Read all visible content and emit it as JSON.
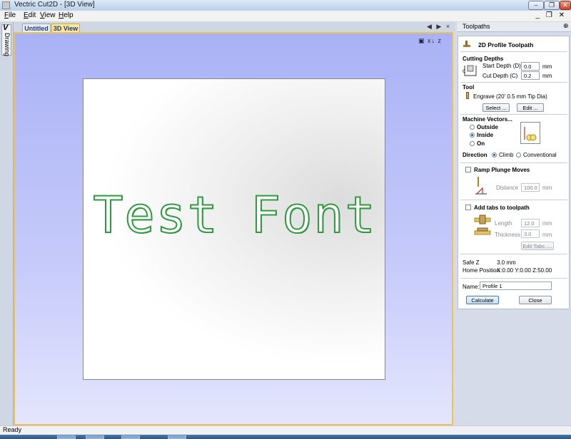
{
  "window": {
    "title": "Vectric Cut2D - [3D View]"
  },
  "menu": [
    "File",
    "Edit",
    "View",
    "Help"
  ],
  "mdi_controls": "_ &#x25A1; ×",
  "left_tab": {
    "glyph": "V",
    "label": "Drawing"
  },
  "doc_tabs": [
    {
      "label": "Untitled",
      "active": false
    },
    {
      "label": "3D View",
      "active": true
    }
  ],
  "doc_tab_nav": "◀ ▶ ×",
  "view": {
    "text": "Test Font",
    "text_color": "#2e9b3e",
    "view_icons": "▣ x↓ z"
  },
  "toolpaths": {
    "header": "Toolpaths",
    "panel_title": "2D Profile Toolpath",
    "cutting_depths": {
      "heading": "Cutting Depths",
      "start_label": "Start Depth (D)",
      "start_value": "0.0",
      "start_unit": "mm",
      "cut_label": "Cut Depth (C)",
      "cut_value": "0.2",
      "cut_unit": "mm"
    },
    "tool": {
      "heading": "Tool",
      "name": "Engrave (20' 0.5 mm Tip Dia)",
      "select_label": "Select ...",
      "edit_label": "Edit ..."
    },
    "machine_vectors": {
      "heading": "Machine Vectors...",
      "options": [
        "Outside",
        "Inside",
        "On"
      ],
      "selected": "Inside"
    },
    "direction": {
      "label": "Direction",
      "options": [
        "Climb",
        "Conventional"
      ],
      "selected": "Climb"
    },
    "ramp": {
      "label": "Ramp Plunge Moves",
      "distance_label": "Distance",
      "distance_value": "100.0",
      "distance_unit": "mm",
      "checked": false
    },
    "tabs": {
      "label": "Add tabs to toolpath",
      "length_label": "Length",
      "length_value": "12.0",
      "length_unit": "mm",
      "thickness_label": "Thickness",
      "thickness_value": "3.0",
      "thickness_unit": "mm",
      "edit_label": "Edit Tabs ....",
      "checked": false
    },
    "safe_z_label": "Safe Z",
    "safe_z_value": "3.0 mm",
    "home_label": "Home Position",
    "home_value": "X:0.00 Y:0.00 Z:50.00",
    "name_label": "Name:",
    "name_value": "Profile 1",
    "calculate_label": "Calculate",
    "close_label": "Close"
  },
  "status": {
    "text": "Ready"
  },
  "colors": {
    "viewport_top": "#a9b2f6",
    "viewport_border": "#f0c050",
    "active_tab": "#fbe7a0"
  }
}
